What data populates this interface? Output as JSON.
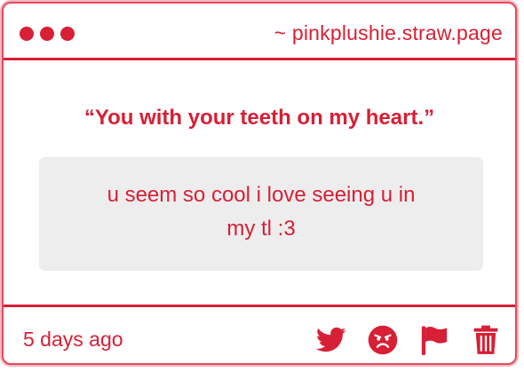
{
  "titlebar": {
    "url": "~ pinkplushie.straw.page"
  },
  "post": {
    "question": "“You with your teeth on my heart.”",
    "answer": "u seem so cool i love seeing u in my tl :3"
  },
  "footer": {
    "timestamp": "5 days ago",
    "actions": [
      "twitter-icon",
      "angry-face-icon",
      "flag-icon",
      "trash-icon"
    ]
  },
  "colors": {
    "accent": "#d71f35",
    "answer_bg": "#ededee"
  }
}
